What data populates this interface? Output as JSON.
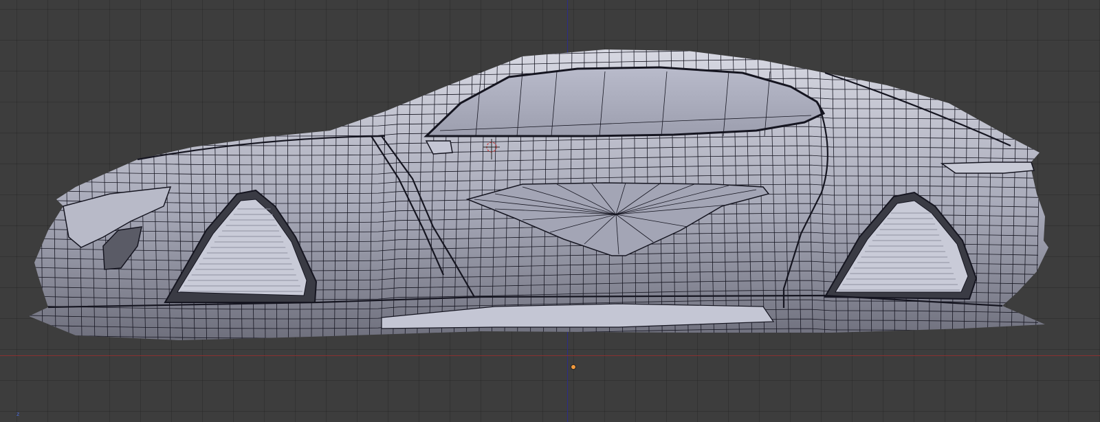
{
  "viewport": {
    "grid_visible": true,
    "background_color": "#3d3d3d",
    "axis_colors": {
      "vertical": "#2c2c88",
      "horizontal": "#8a3030"
    },
    "origin_color": "#f29a3d",
    "cursor_color": "#c85050"
  },
  "model": {
    "icon": "car-mesh-wireframe",
    "render_mode": "solid-with-wireframe",
    "body_color": "#a7a9b8",
    "shadow_color": "#6e6f7c",
    "highlight_color": "#d7d8e2",
    "edge_color": "#151520"
  },
  "widgets": {
    "cursor_icon": "3d-cursor-icon",
    "origin_icon": "object-origin-icon",
    "corner_axis_icon": "view-axis-icon"
  }
}
